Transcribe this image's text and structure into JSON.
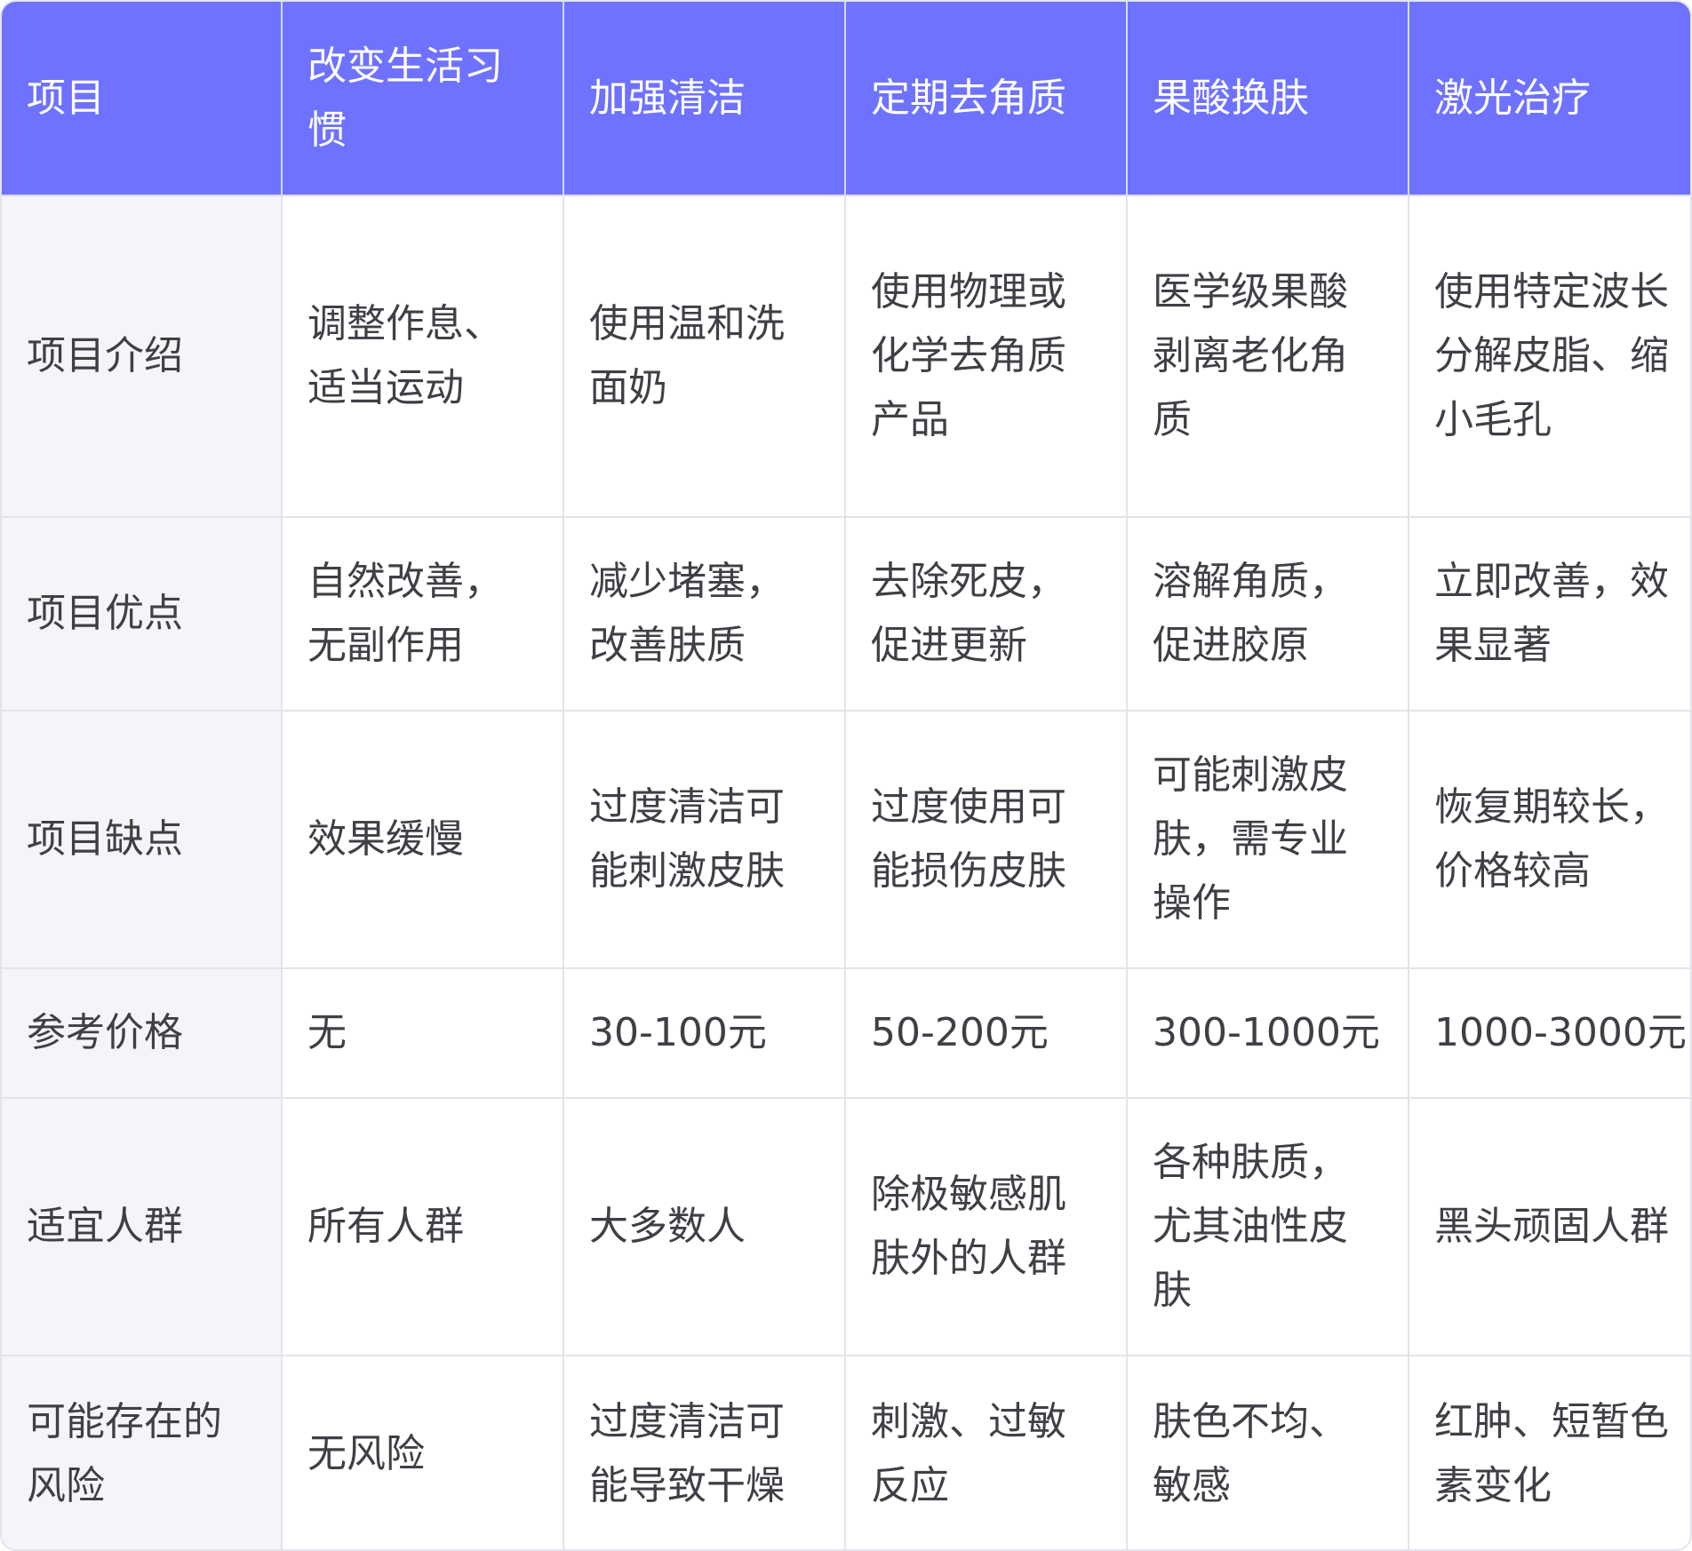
{
  "table": {
    "headers": [
      "项目",
      "改变生活习惯",
      "加强清洁",
      "定期去角质",
      "果酸换肤",
      "激光治疗"
    ],
    "rows": [
      {
        "label": "项目介绍",
        "cells": [
          "调整作息、适当运动",
          "使用温和洗面奶",
          "使用物理或化学去角质产品",
          "医学级果酸剥离老化角质",
          "使用特定波长分解皮脂、缩小毛孔"
        ]
      },
      {
        "label": "项目优点",
        "cells": [
          "自然改善，无副作用",
          "减少堵塞，改善肤质",
          "去除死皮，促进更新",
          "溶解角质，促进胶原",
          "立即改善，效果显著"
        ]
      },
      {
        "label": "项目缺点",
        "cells": [
          "效果缓慢",
          "过度清洁可能刺激皮肤",
          "过度使用可能损伤皮肤",
          "可能刺激皮肤，需专业操作",
          "恢复期较长，价格较高"
        ]
      },
      {
        "label": "参考价格",
        "cells": [
          "无",
          "30-100元",
          "50-200元",
          "300-1000元",
          "1000-3000元"
        ]
      },
      {
        "label": "适宜人群",
        "cells": [
          "所有人群",
          "大多数人",
          "除极敏感肌肤外的人群",
          "各种肤质，尤其油性皮肤",
          "黑头顽固人群"
        ]
      },
      {
        "label": "可能存在的风险",
        "cells": [
          "无风险",
          "过度清洁可能导致干燥",
          "刺激、过敏反应",
          "肤色不均、敏感",
          "红肿、短暂色素变化"
        ]
      }
    ]
  },
  "colors": {
    "header_bg": "#6e72ff",
    "header_text": "#ffffff",
    "row_head_bg": "#f4f5f8",
    "body_text": "#3f4046",
    "border": "#e3e4ea"
  }
}
